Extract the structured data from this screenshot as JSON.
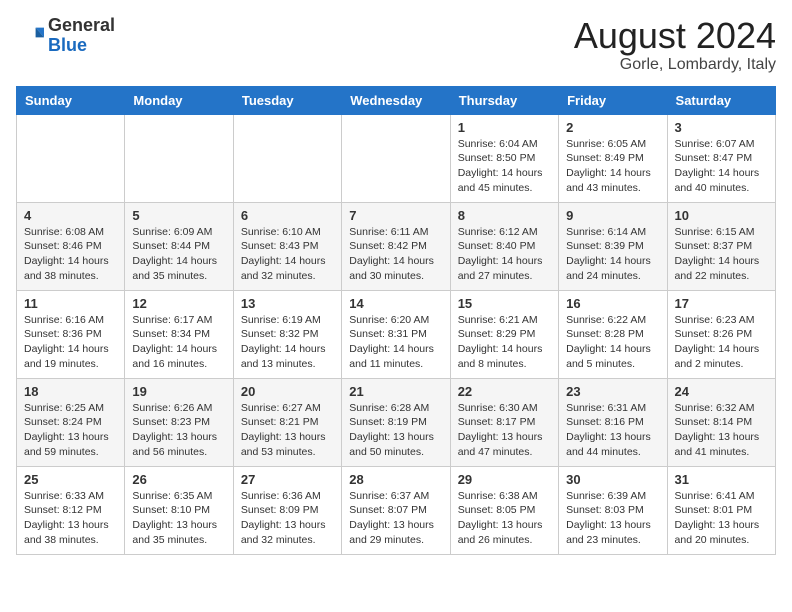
{
  "header": {
    "logo_general": "General",
    "logo_blue": "Blue",
    "month_year": "August 2024",
    "location": "Gorle, Lombardy, Italy"
  },
  "days_of_week": [
    "Sunday",
    "Monday",
    "Tuesday",
    "Wednesday",
    "Thursday",
    "Friday",
    "Saturday"
  ],
  "weeks": [
    [
      {
        "day": "",
        "info": ""
      },
      {
        "day": "",
        "info": ""
      },
      {
        "day": "",
        "info": ""
      },
      {
        "day": "",
        "info": ""
      },
      {
        "day": "1",
        "info": "Sunrise: 6:04 AM\nSunset: 8:50 PM\nDaylight: 14 hours\nand 45 minutes."
      },
      {
        "day": "2",
        "info": "Sunrise: 6:05 AM\nSunset: 8:49 PM\nDaylight: 14 hours\nand 43 minutes."
      },
      {
        "day": "3",
        "info": "Sunrise: 6:07 AM\nSunset: 8:47 PM\nDaylight: 14 hours\nand 40 minutes."
      }
    ],
    [
      {
        "day": "4",
        "info": "Sunrise: 6:08 AM\nSunset: 8:46 PM\nDaylight: 14 hours\nand 38 minutes."
      },
      {
        "day": "5",
        "info": "Sunrise: 6:09 AM\nSunset: 8:44 PM\nDaylight: 14 hours\nand 35 minutes."
      },
      {
        "day": "6",
        "info": "Sunrise: 6:10 AM\nSunset: 8:43 PM\nDaylight: 14 hours\nand 32 minutes."
      },
      {
        "day": "7",
        "info": "Sunrise: 6:11 AM\nSunset: 8:42 PM\nDaylight: 14 hours\nand 30 minutes."
      },
      {
        "day": "8",
        "info": "Sunrise: 6:12 AM\nSunset: 8:40 PM\nDaylight: 14 hours\nand 27 minutes."
      },
      {
        "day": "9",
        "info": "Sunrise: 6:14 AM\nSunset: 8:39 PM\nDaylight: 14 hours\nand 24 minutes."
      },
      {
        "day": "10",
        "info": "Sunrise: 6:15 AM\nSunset: 8:37 PM\nDaylight: 14 hours\nand 22 minutes."
      }
    ],
    [
      {
        "day": "11",
        "info": "Sunrise: 6:16 AM\nSunset: 8:36 PM\nDaylight: 14 hours\nand 19 minutes."
      },
      {
        "day": "12",
        "info": "Sunrise: 6:17 AM\nSunset: 8:34 PM\nDaylight: 14 hours\nand 16 minutes."
      },
      {
        "day": "13",
        "info": "Sunrise: 6:19 AM\nSunset: 8:32 PM\nDaylight: 14 hours\nand 13 minutes."
      },
      {
        "day": "14",
        "info": "Sunrise: 6:20 AM\nSunset: 8:31 PM\nDaylight: 14 hours\nand 11 minutes."
      },
      {
        "day": "15",
        "info": "Sunrise: 6:21 AM\nSunset: 8:29 PM\nDaylight: 14 hours\nand 8 minutes."
      },
      {
        "day": "16",
        "info": "Sunrise: 6:22 AM\nSunset: 8:28 PM\nDaylight: 14 hours\nand 5 minutes."
      },
      {
        "day": "17",
        "info": "Sunrise: 6:23 AM\nSunset: 8:26 PM\nDaylight: 14 hours\nand 2 minutes."
      }
    ],
    [
      {
        "day": "18",
        "info": "Sunrise: 6:25 AM\nSunset: 8:24 PM\nDaylight: 13 hours\nand 59 minutes."
      },
      {
        "day": "19",
        "info": "Sunrise: 6:26 AM\nSunset: 8:23 PM\nDaylight: 13 hours\nand 56 minutes."
      },
      {
        "day": "20",
        "info": "Sunrise: 6:27 AM\nSunset: 8:21 PM\nDaylight: 13 hours\nand 53 minutes."
      },
      {
        "day": "21",
        "info": "Sunrise: 6:28 AM\nSunset: 8:19 PM\nDaylight: 13 hours\nand 50 minutes."
      },
      {
        "day": "22",
        "info": "Sunrise: 6:30 AM\nSunset: 8:17 PM\nDaylight: 13 hours\nand 47 minutes."
      },
      {
        "day": "23",
        "info": "Sunrise: 6:31 AM\nSunset: 8:16 PM\nDaylight: 13 hours\nand 44 minutes."
      },
      {
        "day": "24",
        "info": "Sunrise: 6:32 AM\nSunset: 8:14 PM\nDaylight: 13 hours\nand 41 minutes."
      }
    ],
    [
      {
        "day": "25",
        "info": "Sunrise: 6:33 AM\nSunset: 8:12 PM\nDaylight: 13 hours\nand 38 minutes."
      },
      {
        "day": "26",
        "info": "Sunrise: 6:35 AM\nSunset: 8:10 PM\nDaylight: 13 hours\nand 35 minutes."
      },
      {
        "day": "27",
        "info": "Sunrise: 6:36 AM\nSunset: 8:09 PM\nDaylight: 13 hours\nand 32 minutes."
      },
      {
        "day": "28",
        "info": "Sunrise: 6:37 AM\nSunset: 8:07 PM\nDaylight: 13 hours\nand 29 minutes."
      },
      {
        "day": "29",
        "info": "Sunrise: 6:38 AM\nSunset: 8:05 PM\nDaylight: 13 hours\nand 26 minutes."
      },
      {
        "day": "30",
        "info": "Sunrise: 6:39 AM\nSunset: 8:03 PM\nDaylight: 13 hours\nand 23 minutes."
      },
      {
        "day": "31",
        "info": "Sunrise: 6:41 AM\nSunset: 8:01 PM\nDaylight: 13 hours\nand 20 minutes."
      }
    ]
  ]
}
